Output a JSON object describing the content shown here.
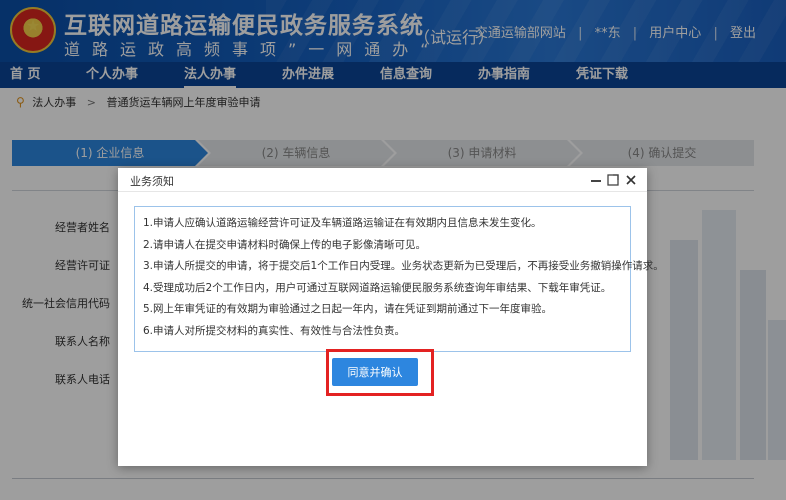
{
  "header": {
    "title": "互联网道路运输便民政务服务系统",
    "subtitle": "道路运政高频事项”一网通办“",
    "trial": "（试运行）",
    "links": [
      "交通运输部网站",
      "**东",
      "用户中心",
      "登出"
    ],
    "link_separator": "|"
  },
  "nav": {
    "items": [
      "首 页",
      "个人办事",
      "法人办事",
      "办件进展",
      "信息查询",
      "办事指南",
      "凭证下载"
    ],
    "active": "法人办事"
  },
  "breadcrumb": {
    "items": [
      "法人办事",
      "普通货运车辆网上年度审验申请"
    ],
    "separator": ">"
  },
  "steps": [
    {
      "number": "1",
      "label": "企业信息",
      "active": true
    },
    {
      "number": "2",
      "label": "车辆信息",
      "active": false
    },
    {
      "number": "3",
      "label": "申请材料",
      "active": false
    },
    {
      "number": "4",
      "label": "确认提交",
      "active": false
    }
  ],
  "form": {
    "labels": [
      "经营者姓名",
      "经营许可证",
      "统一社会信用代码",
      "联系人名称",
      "联系人电话"
    ]
  },
  "dialog": {
    "title": "业务须知",
    "lines": [
      "1.申请人应确认道路运输经营许可证及车辆道路运输证在有效期内且信息未发生变化。",
      "2.请申请人在提交申请材料时确保上传的电子影像清晰可见。",
      "3.申请人所提交的申请，将于提交后1个工作日内受理。业务状态更新为已受理后，不再接受业务撤销操作请求。",
      "4.受理成功后2个工作日内，用户可通过互联网道路运输便民服务系统查询年审结果、下载年审凭证。",
      "5.网上年审凭证的有效期为审验通过之日起一年内，请在凭证到期前通过下一年度审验。",
      "6.申请人对所提交材料的真实性、有效性与合法性负责。"
    ],
    "agree_label": "同意并确认"
  },
  "colors": {
    "header_blue": "#1763c4",
    "nav_blue": "#0b4597",
    "step_active": "#2d86df",
    "highlight_red": "#e32222",
    "button_blue": "#2d86df"
  },
  "icons": {
    "breadcrumb": "location-pin-icon",
    "minimize": "minimize-icon",
    "maximize": "maximize-icon",
    "close": "close-icon"
  }
}
